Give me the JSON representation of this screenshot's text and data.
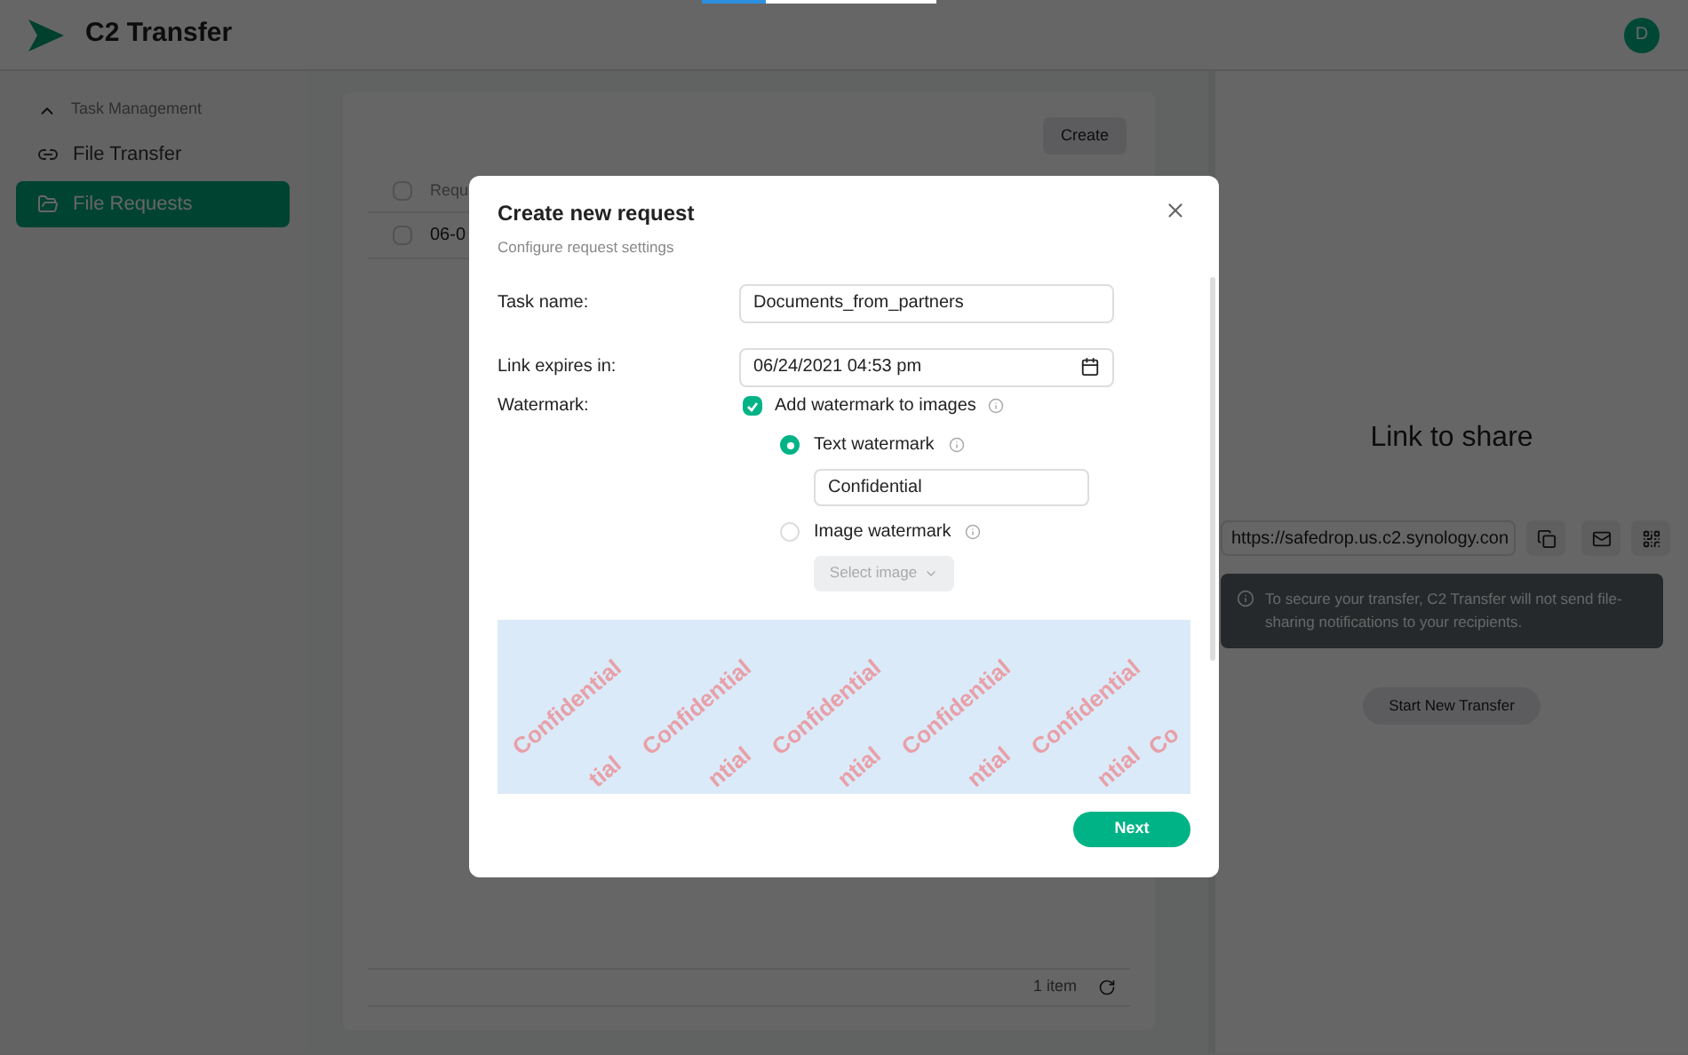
{
  "loading_bar": {
    "level": 0.27
  },
  "app": {
    "title": "C2 Transfer",
    "avatar": "D"
  },
  "sidebar": {
    "section": {
      "label": "Task Management",
      "expanded": true
    },
    "items": [
      {
        "label": "File Transfer",
        "selected": false
      },
      {
        "label": "File Requests",
        "selected": true
      }
    ]
  },
  "list": {
    "create_button": "Create",
    "header": {
      "label": "Requ",
      "checked": false
    },
    "rows": [
      {
        "cell": "06-0",
        "checked": false
      }
    ],
    "footer": "1 item"
  },
  "share_panel": {
    "title": "Link to share",
    "link": "https://safedrop.us.c2.synology.con",
    "notice": "To secure your transfer, C2 Transfer will not send file-sharing notifications to your recipients.",
    "button": "Start New Transfer"
  },
  "dialog": {
    "title": "Create new request",
    "subtitle": "Configure request settings",
    "task_name": {
      "label": "Task name:",
      "value": "Documents_from_partners"
    },
    "expires": {
      "label": "Link expires in:",
      "value": "06/24/2021 04:53 pm"
    },
    "watermark": {
      "label": "Watermark:",
      "checkbox": {
        "label": "Add watermark to images",
        "checked": true
      },
      "options": [
        {
          "kind": "text",
          "label": "Text watermark",
          "selected": true,
          "value": "Confidential"
        },
        {
          "kind": "image",
          "label": "Image watermark",
          "selected": false,
          "button": "Select image",
          "disabled": true
        }
      ]
    },
    "preview": {
      "top_row": [
        "Confidential",
        "Confidential",
        "Confidential",
        "Confidential",
        "Confidential",
        "Co"
      ],
      "bottom_row": [
        "tial",
        "ntial",
        "ntial",
        "ntial",
        "ntial"
      ]
    },
    "next_button": "Next"
  }
}
